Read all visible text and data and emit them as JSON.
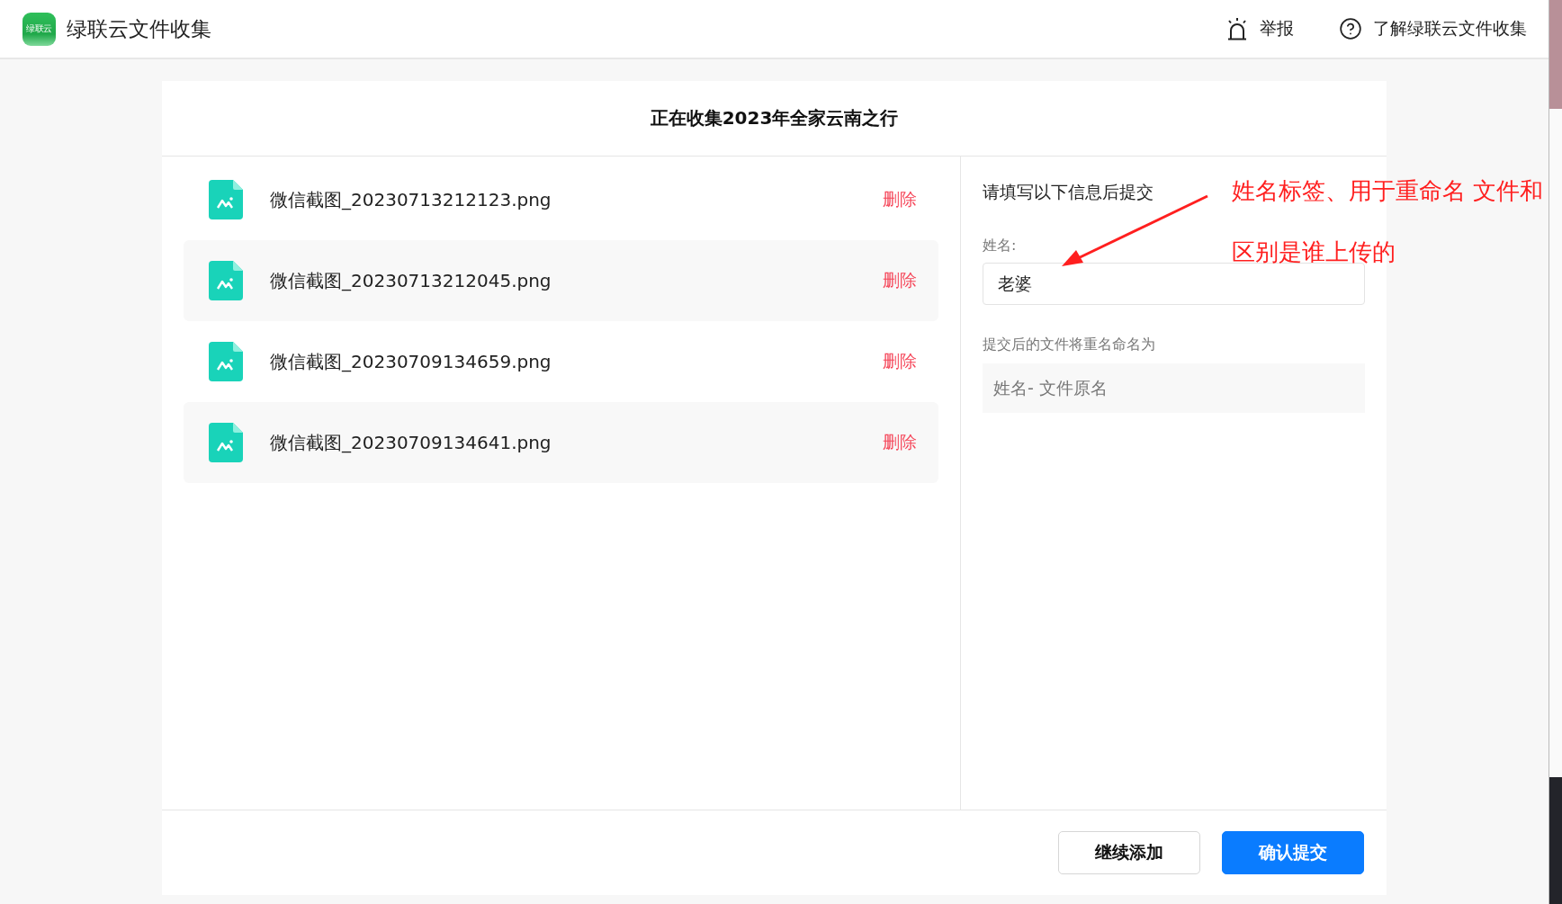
{
  "header": {
    "logo_text": "绿联云",
    "title": "绿联云文件收集",
    "actions": [
      {
        "kind": "report",
        "label": "举报"
      },
      {
        "kind": "help",
        "label": "了解绿联云文件收集"
      }
    ]
  },
  "card": {
    "title": "正在收集2023年全家云南之行"
  },
  "files": [
    {
      "name": "微信截图_20230713212123.png",
      "action": "删除"
    },
    {
      "name": "微信截图_20230713212045.png",
      "action": "删除"
    },
    {
      "name": "微信截图_20230709134659.png",
      "action": "删除"
    },
    {
      "name": "微信截图_20230709134641.png",
      "action": "删除"
    }
  ],
  "form": {
    "heading": "请填写以下信息后提交",
    "name_label": "姓名:",
    "name_value": "老婆",
    "rename_label": "提交后的文件将重名命名为",
    "rename_value": "姓名- 文件原名"
  },
  "annotation": {
    "lines": [
      "姓名标签、用于重命名 文件和",
      "区别是谁上传的"
    ]
  },
  "buttons": [
    {
      "kind": "secondary",
      "label": "继续添加"
    },
    {
      "kind": "primary",
      "label": "确认提交"
    }
  ]
}
